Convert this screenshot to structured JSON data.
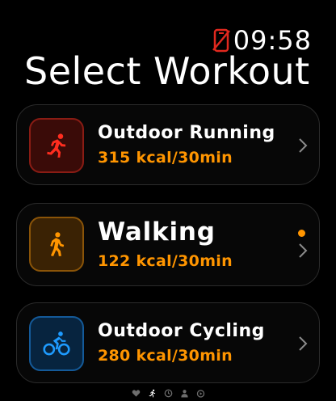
{
  "status": {
    "time": "09:58",
    "icon": "phone-disconnected-icon",
    "icon_color": "#e0281e"
  },
  "title": "Select Workout",
  "workouts": [
    {
      "name": "Outdoor Running",
      "kcal": "315 kcal/30min",
      "icon": "running-icon",
      "color": "#ff2d1f",
      "box_bg": "#3a0b08"
    },
    {
      "name": "Walking",
      "kcal": "122 kcal/30min",
      "icon": "walking-icon",
      "color": "#ff9500",
      "box_bg": "#3a2204",
      "badge": "orange-dot"
    },
    {
      "name": "Outdoor Cycling",
      "kcal": "280 kcal/30min",
      "icon": "cycling-icon",
      "color": "#1e9bff",
      "box_bg": "#07243f"
    }
  ],
  "accent_color": "#ff9500",
  "pager": [
    "heart-icon",
    "running-icon",
    "clock-icon",
    "person-icon",
    "timer-icon"
  ]
}
